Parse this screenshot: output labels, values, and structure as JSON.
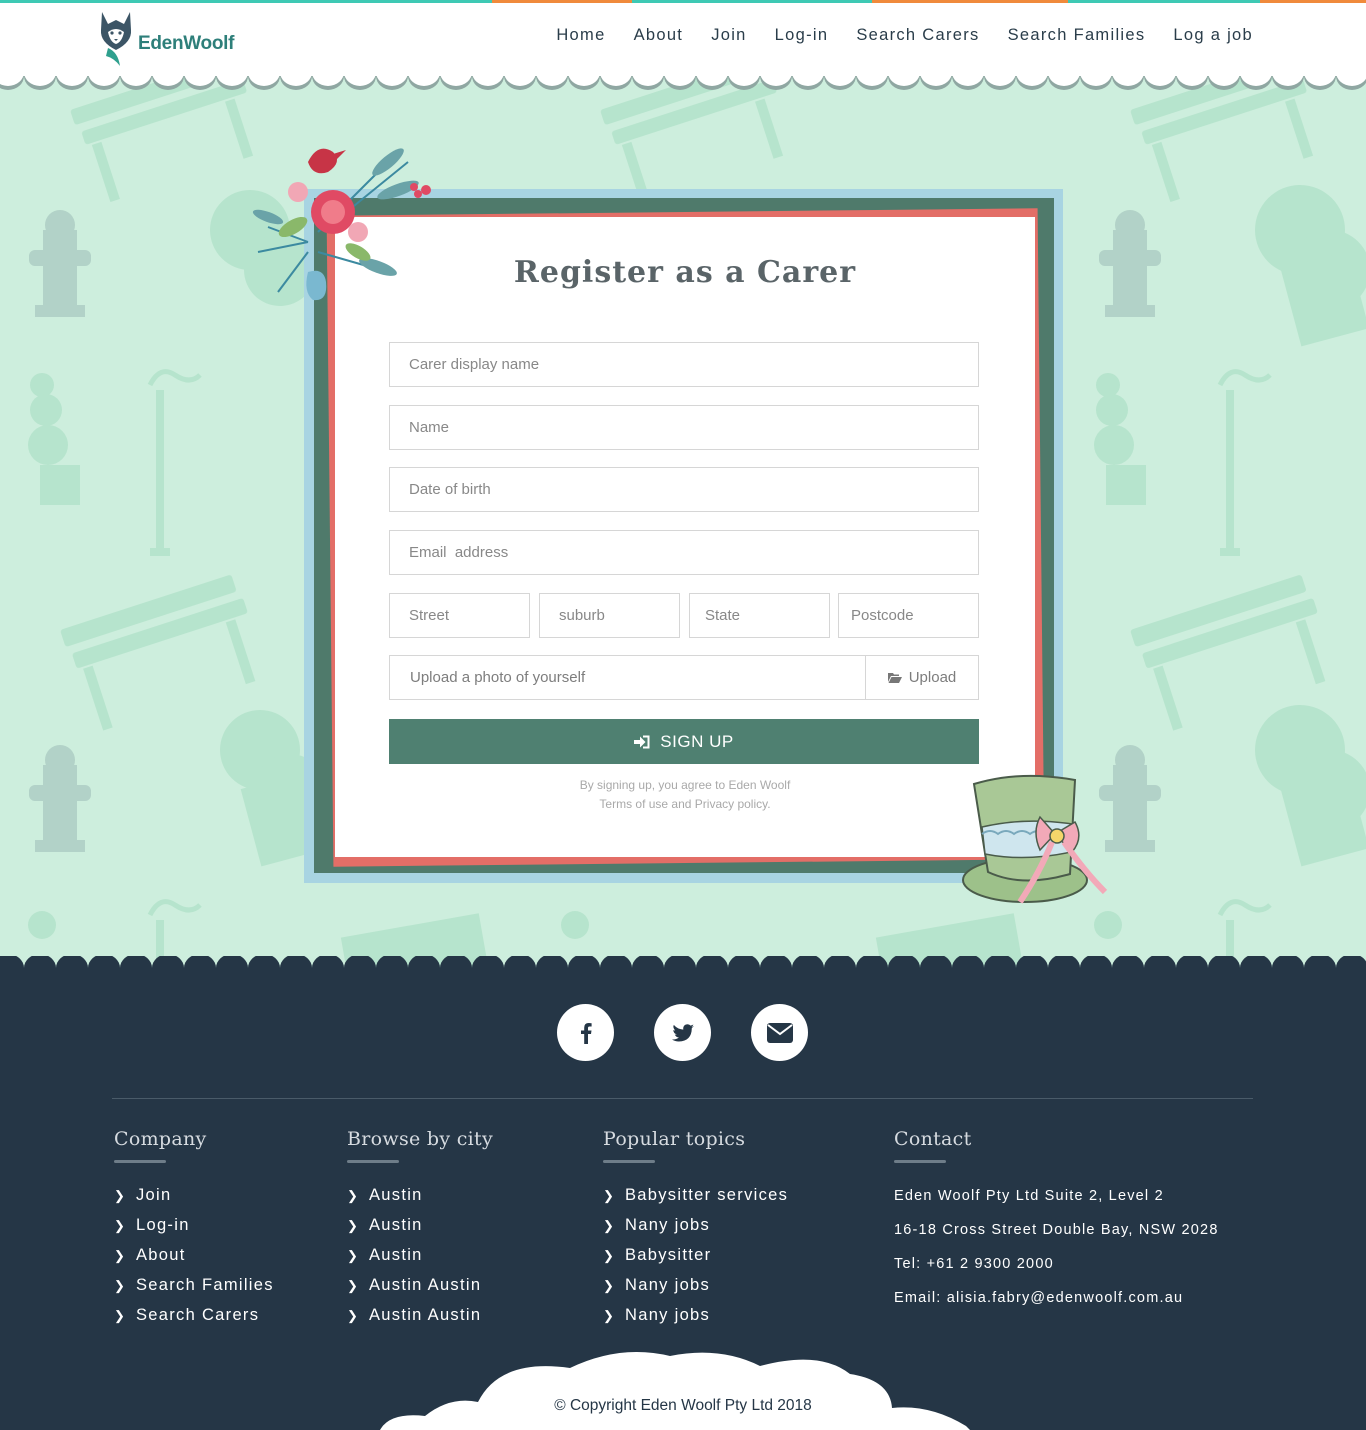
{
  "brand": {
    "name": "EdenWoolf"
  },
  "nav": {
    "items": [
      {
        "label": "Home"
      },
      {
        "label": "About"
      },
      {
        "label": "Join"
      },
      {
        "label": "Log-in"
      },
      {
        "label": "Search Carers"
      },
      {
        "label": "Search Families"
      },
      {
        "label": "Log a job"
      }
    ]
  },
  "colors": {
    "teal": "#3ec9b4",
    "orange": "#f08a3c",
    "mint_bg": "#cdeedd",
    "frame_green": "#4f7a6b",
    "frame_blue": "#a8d4e2",
    "frame_red": "#e36e67",
    "button_green": "#4f8071",
    "footer_navy": "#253646"
  },
  "form": {
    "title": "Register as a Carer",
    "fields": {
      "display_name": "Carer display name",
      "name": "Name",
      "dob": "Date of birth",
      "email": "Email  address",
      "street": "Street",
      "suburb": "suburb",
      "state": "State",
      "postcode": "Postcode"
    },
    "upload": {
      "placeholder": "Upload a photo of yourself",
      "button": "Upload",
      "icon": "folder-open-icon"
    },
    "submit": {
      "label": "SIGN UP",
      "icon": "sign-in-icon"
    },
    "terms_line1": "By signing up, you agree to Eden Woolf",
    "terms_line2": "Terms of use and Privacy policy."
  },
  "footer": {
    "social": [
      {
        "icon": "facebook-icon"
      },
      {
        "icon": "twitter-icon"
      },
      {
        "icon": "envelope-icon"
      }
    ],
    "company": {
      "title": "Company",
      "items": [
        "Join",
        "Log-in",
        "About",
        "Search Families",
        "Search Carers"
      ]
    },
    "cities": {
      "title": "Browse by city",
      "items": [
        "Austin",
        "Austin",
        "Austin",
        "Austin Austin",
        "Austin Austin"
      ]
    },
    "topics": {
      "title": "Popular topics",
      "items": [
        "Babysitter services",
        "Nany jobs",
        "Babysitter",
        "Nany jobs",
        "Nany jobs"
      ]
    },
    "contact": {
      "title": "Contact",
      "line1": "Eden Woolf Pty Ltd Suite 2, Level 2",
      "line2": "16-18 Cross Street Double Bay, NSW 2028",
      "line3": "Tel: +61 2 9300 2000",
      "line4": "Email: alisia.fabry@edenwoolf.com.au"
    },
    "copyright": "© Copyright Eden Woolf Pty Ltd 2018"
  }
}
